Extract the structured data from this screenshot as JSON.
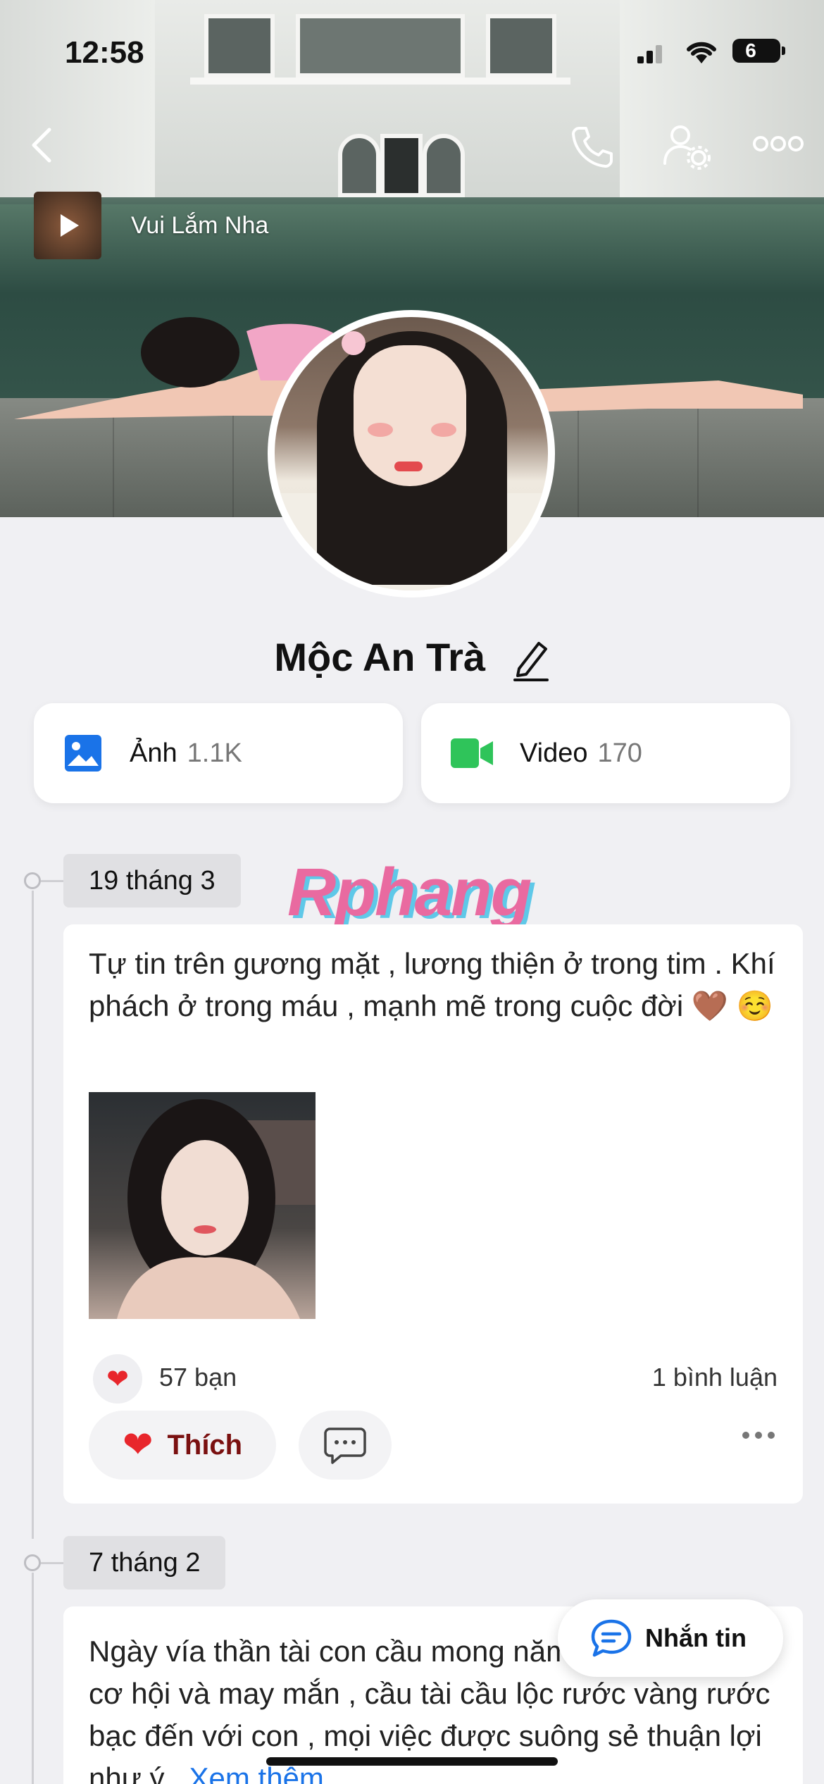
{
  "status_bar": {
    "time": "12:58",
    "battery": "6"
  },
  "music": {
    "title": "Vui Lắm Nha"
  },
  "profile": {
    "name": "Mộc An Trà"
  },
  "media": [
    {
      "label": "Ảnh",
      "count": "1.1K",
      "icon": "image-icon"
    },
    {
      "label": "Video",
      "count": "170",
      "icon": "video-icon"
    }
  ],
  "watermark": "Rphang",
  "posts": [
    {
      "date": "19 tháng 3",
      "text": "Tự tin trên gương mặt , lương thiện ở trong tim . Khí phách ở trong máu , mạnh mẽ trong cuộc đời 🤎 ☺️",
      "likes": "57 bạn",
      "comments": "1 bình luận",
      "like_label": "Thích"
    },
    {
      "date": "7 tháng 2",
      "text": "Ngày vía thần tài  con cầu mong năm mới với nhiều cơ hội và may mắn , cầu tài cầu lộc rước vàng rước bạc đến với con , mọi việc được suông sẻ thuận lợi như ý...",
      "more_link": "Xem thêm"
    }
  ],
  "message_button": {
    "label": "Nhắn tin"
  },
  "colors": {
    "accent": "#1a73e8",
    "heart": "#e8262c",
    "video_green": "#2fc45a",
    "background": "#f0f0f3"
  }
}
